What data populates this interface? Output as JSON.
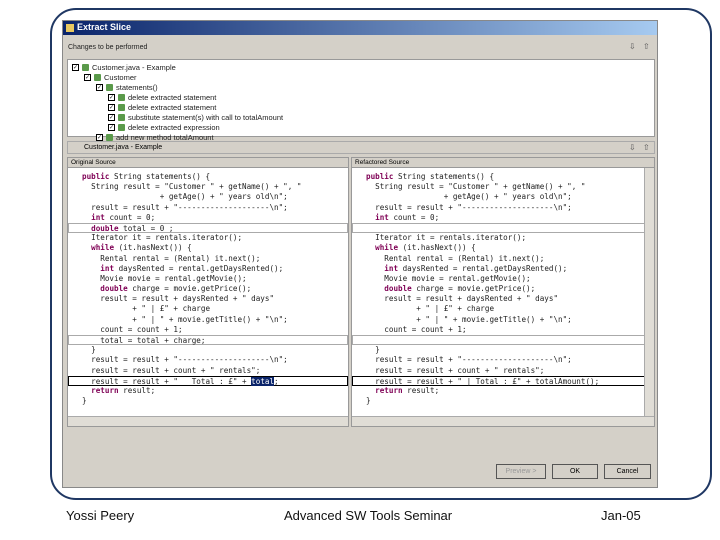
{
  "dialog": {
    "title": "Extract Slice",
    "changes_label": "Changes to be performed",
    "tree": [
      {
        "label": "Customer.java - Example",
        "level": 0,
        "checked": true,
        "icon": "file-icon"
      },
      {
        "label": "Customer",
        "level": 1,
        "checked": true,
        "icon": "class-icon"
      },
      {
        "label": "statements()",
        "level": 2,
        "checked": true,
        "icon": "method-icon"
      },
      {
        "label": "delete extracted statement",
        "level": 3,
        "checked": true,
        "icon": "change-icon"
      },
      {
        "label": "delete extracted statement",
        "level": 3,
        "checked": true,
        "icon": "change-icon"
      },
      {
        "label": "substitute statement(s) with call to totalAmount",
        "level": 3,
        "checked": true,
        "icon": "change-icon"
      },
      {
        "label": "delete extracted expression",
        "level": 3,
        "checked": true,
        "icon": "change-icon"
      },
      {
        "label": "add new method totalAmount",
        "level": 2,
        "checked": true,
        "icon": "change-icon"
      }
    ],
    "compare_file": "Customer.java - Example",
    "left_title": "Original Source",
    "right_title": "Refactored Source",
    "buttons": {
      "preview": "Preview >",
      "ok": "OK",
      "cancel": "Cancel"
    }
  },
  "left_source": {
    "lines": [
      {
        "s": [
          {
            "k": "kw",
            "t": "public"
          },
          {
            "t": " String statements() {"
          }
        ]
      },
      {
        "s": [
          {
            "t": "  String result = \"Customer \" + getName() + \", \""
          }
        ]
      },
      {
        "s": [
          {
            "t": "                 + getAge() + \" years old\\n\";"
          }
        ]
      },
      {
        "s": [
          {
            "t": "  result = result + \"--------------------\\n\";"
          }
        ]
      },
      {
        "s": [
          {
            "t": "  "
          },
          {
            "k": "kw",
            "t": "int"
          },
          {
            "t": " count = 0;"
          }
        ]
      },
      {
        "b": "box",
        "s": [
          {
            "t": "  "
          },
          {
            "k": "kw",
            "t": "double"
          },
          {
            "t": " total = 0 ;"
          }
        ]
      },
      {
        "s": [
          {
            "t": "  Iterator it = rentals.iterator();"
          }
        ]
      },
      {
        "s": [
          {
            "t": "  "
          },
          {
            "k": "kw",
            "t": "while"
          },
          {
            "t": " (it.hasNext()) {"
          }
        ]
      },
      {
        "s": [
          {
            "t": "    Rental rental = (Rental) it.next();"
          }
        ]
      },
      {
        "s": [
          {
            "t": "    "
          },
          {
            "k": "kw",
            "t": "int"
          },
          {
            "t": " daysRented = rental.getDaysRented();"
          }
        ]
      },
      {
        "s": [
          {
            "t": "    Movie movie = rental.getMovie();"
          }
        ]
      },
      {
        "s": [
          {
            "t": "    "
          },
          {
            "k": "kw",
            "t": "double"
          },
          {
            "t": " charge = movie.getPrice();"
          }
        ]
      },
      {
        "s": [
          {
            "t": "    result = result + daysRented + \" days\""
          }
        ]
      },
      {
        "s": [
          {
            "t": "           + \" | £\" + charge"
          }
        ]
      },
      {
        "s": [
          {
            "t": "           + \" | \" + movie.getTitle() + \"\\n\";"
          }
        ]
      },
      {
        "s": [
          {
            "t": "    count = count + 1;"
          }
        ]
      },
      {
        "b": "box",
        "s": [
          {
            "t": "    total = total + charge;"
          }
        ]
      },
      {
        "s": [
          {
            "t": "  }"
          }
        ]
      },
      {
        "s": [
          {
            "t": "  result = result + \"--------------------\\n\";"
          }
        ]
      },
      {
        "s": [
          {
            "t": "  result = result + count + \" rentals\";"
          }
        ]
      },
      {
        "b": "boxd",
        "s": [
          {
            "t": "  result = result + \"   Total : £\" + "
          },
          {
            "k": "sel",
            "t": "total"
          },
          {
            "t": ";"
          }
        ]
      },
      {
        "s": [
          {
            "t": "  "
          },
          {
            "k": "kw",
            "t": "return"
          },
          {
            "t": " result;"
          }
        ]
      },
      {
        "s": [
          {
            "t": "}"
          }
        ]
      }
    ]
  },
  "right_source": {
    "lines": [
      {
        "s": [
          {
            "k": "kw",
            "t": "public"
          },
          {
            "t": " String statements() {"
          }
        ]
      },
      {
        "s": [
          {
            "t": "  String result = \"Customer \" + getName() + \", \""
          }
        ]
      },
      {
        "s": [
          {
            "t": "                 + getAge() + \" years old\\n\";"
          }
        ]
      },
      {
        "s": [
          {
            "t": "  result = result + \"--------------------\\n\";"
          }
        ]
      },
      {
        "s": [
          {
            "t": "  "
          },
          {
            "k": "kw",
            "t": "int"
          },
          {
            "t": " count = 0;"
          }
        ]
      },
      {
        "b": "box",
        "s": [
          {
            "t": ""
          }
        ]
      },
      {
        "s": [
          {
            "t": "  Iterator it = rentals.iterator();"
          }
        ]
      },
      {
        "s": [
          {
            "t": "  "
          },
          {
            "k": "kw",
            "t": "while"
          },
          {
            "t": " (it.hasNext()) {"
          }
        ]
      },
      {
        "s": [
          {
            "t": "    Rental rental = (Rental) it.next();"
          }
        ]
      },
      {
        "s": [
          {
            "t": "    "
          },
          {
            "k": "kw",
            "t": "int"
          },
          {
            "t": " daysRented = rental.getDaysRented();"
          }
        ]
      },
      {
        "s": [
          {
            "t": "    Movie movie = rental.getMovie();"
          }
        ]
      },
      {
        "s": [
          {
            "t": "    "
          },
          {
            "k": "kw",
            "t": "double"
          },
          {
            "t": " charge = movie.getPrice();"
          }
        ]
      },
      {
        "s": [
          {
            "t": "    result = result + daysRented + \" days\""
          }
        ]
      },
      {
        "s": [
          {
            "t": "           + \" | £\" + charge"
          }
        ]
      },
      {
        "s": [
          {
            "t": "           + \" | \" + movie.getTitle() + \"\\n\";"
          }
        ]
      },
      {
        "s": [
          {
            "t": "    count = count + 1;"
          }
        ]
      },
      {
        "b": "box",
        "s": [
          {
            "t": ""
          }
        ]
      },
      {
        "s": [
          {
            "t": "  }"
          }
        ]
      },
      {
        "s": [
          {
            "t": "  result = result + \"--------------------\\n\";"
          }
        ]
      },
      {
        "s": [
          {
            "t": "  result = result + count + \" rentals\";"
          }
        ]
      },
      {
        "b": "boxd",
        "s": [
          {
            "t": "  result = result + \" | Total : £\" + totalAmount();"
          }
        ]
      },
      {
        "s": [
          {
            "t": "  "
          },
          {
            "k": "kw",
            "t": "return"
          },
          {
            "t": " result;"
          }
        ]
      },
      {
        "s": [
          {
            "t": "}"
          }
        ]
      }
    ]
  },
  "footer": {
    "author": "Yossi Peery",
    "title": "Advanced SW Tools Seminar",
    "date": "Jan-05"
  }
}
